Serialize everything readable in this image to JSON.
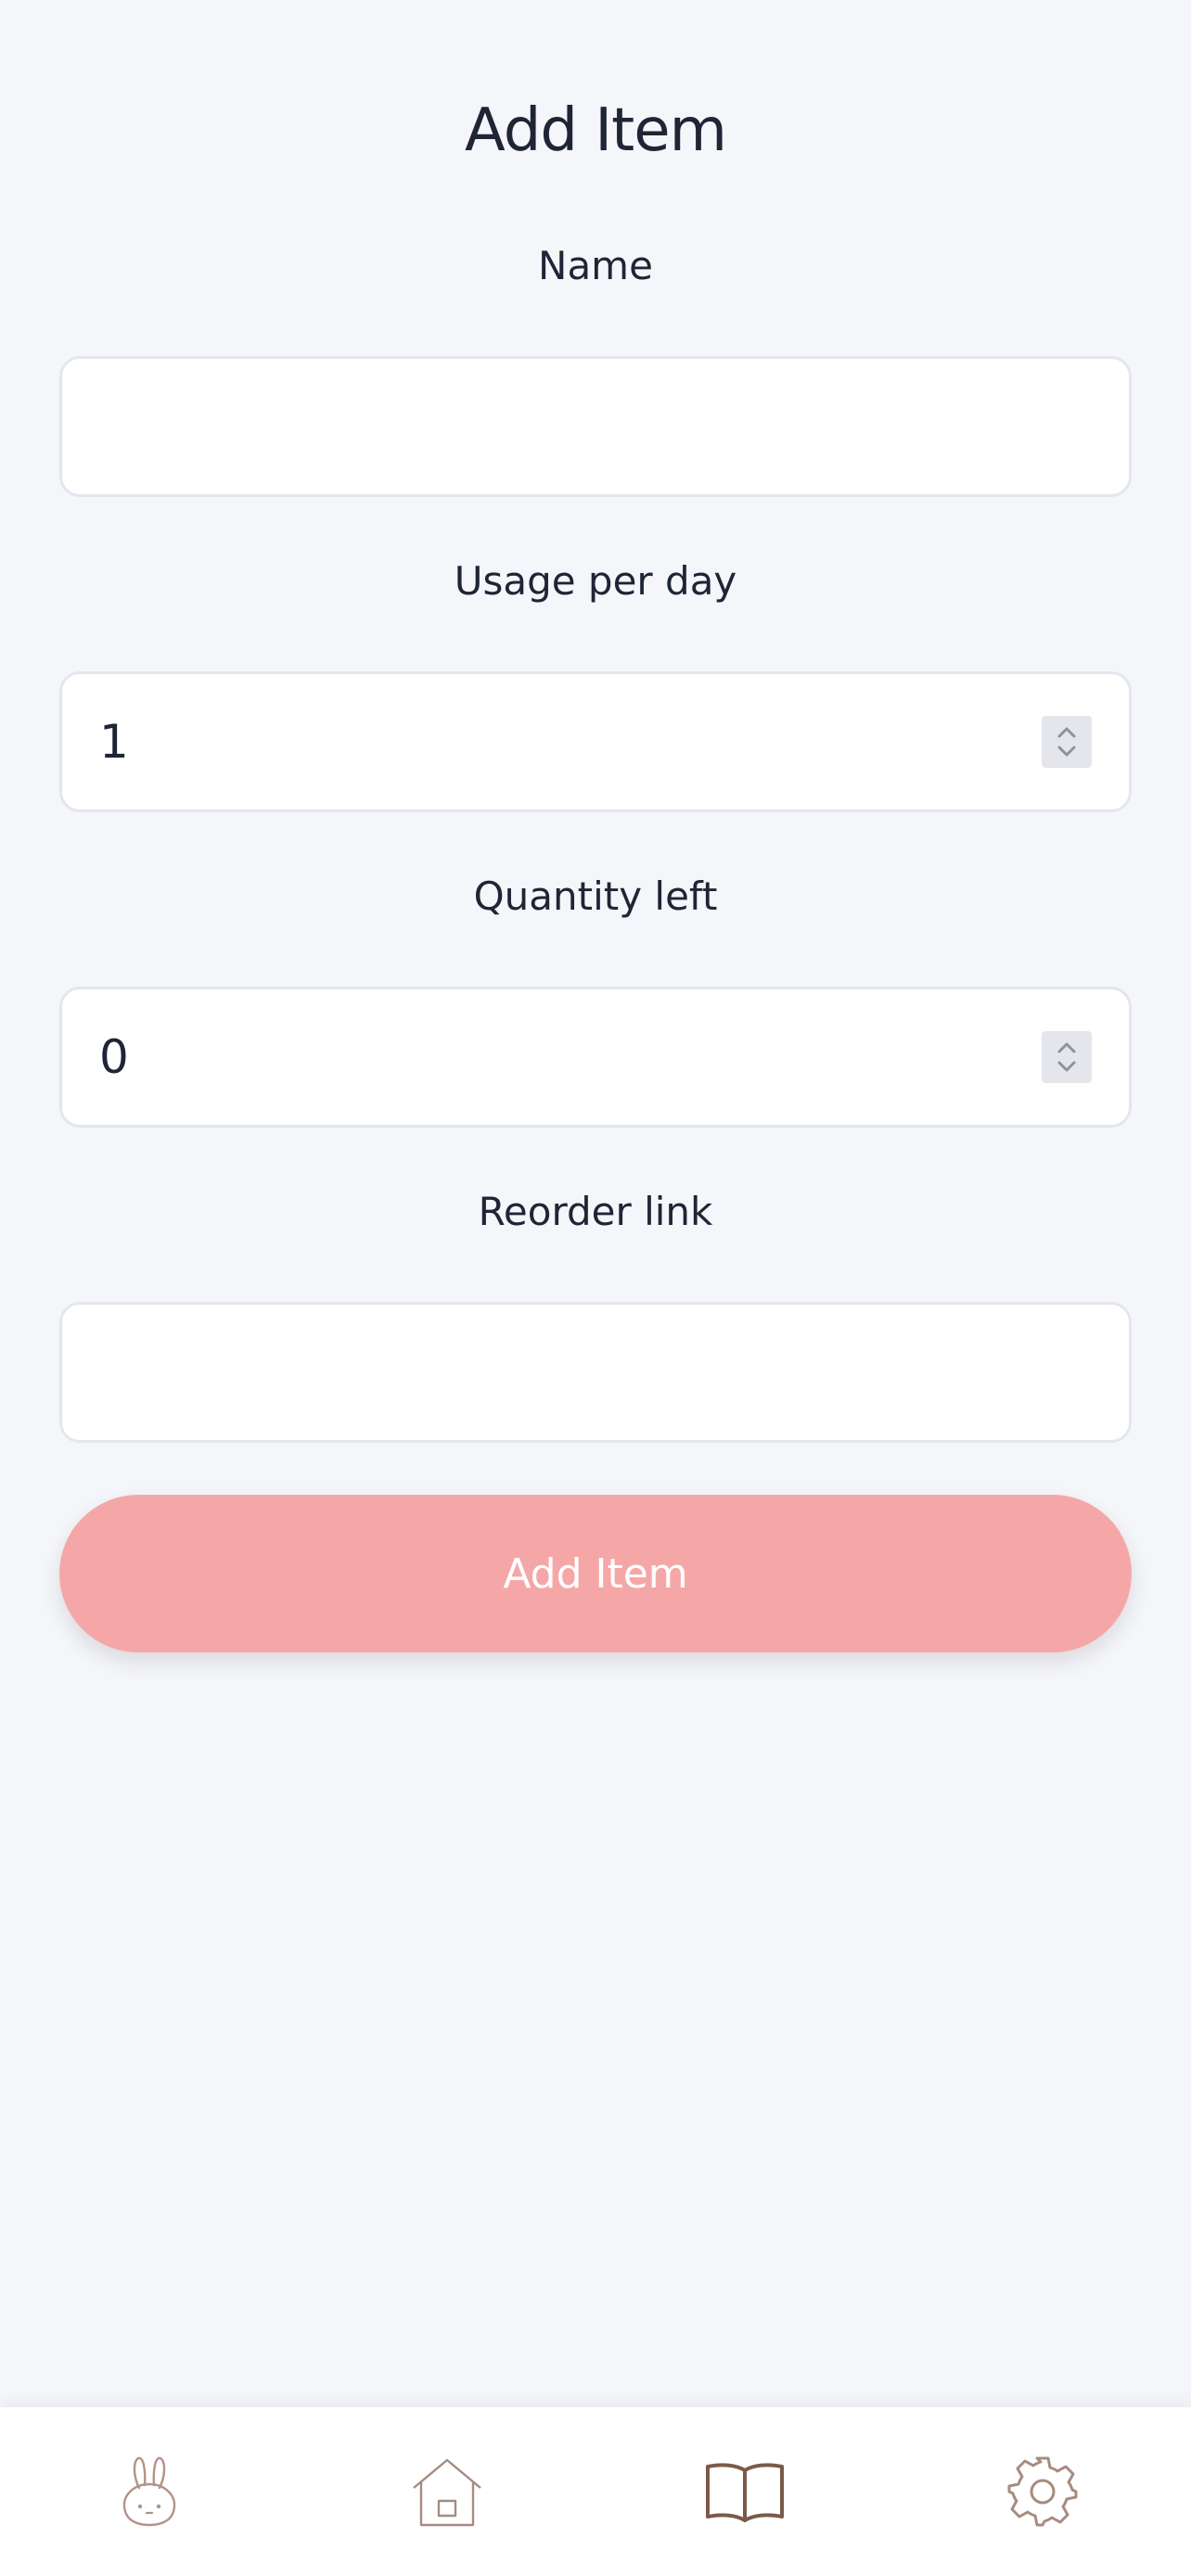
{
  "page": {
    "title": "Add Item"
  },
  "form": {
    "name": {
      "label": "Name",
      "value": "",
      "placeholder": ""
    },
    "usage_per_day": {
      "label": "Usage per day",
      "value": "1"
    },
    "quantity_left": {
      "label": "Quantity left",
      "value": "0"
    },
    "reorder_link": {
      "label": "Reorder link",
      "value": "",
      "placeholder": ""
    },
    "submit_label": "Add Item"
  },
  "colors": {
    "background": "#f4f6fa",
    "button": "#f5a7a7",
    "icon_brown": "#7a5a48",
    "icon_muted": "#a58c80"
  },
  "tabbar": {
    "items": [
      {
        "icon": "bunny-icon",
        "active": false
      },
      {
        "icon": "home-icon",
        "active": false
      },
      {
        "icon": "book-icon",
        "active": true
      },
      {
        "icon": "gear-icon",
        "active": false
      }
    ]
  }
}
